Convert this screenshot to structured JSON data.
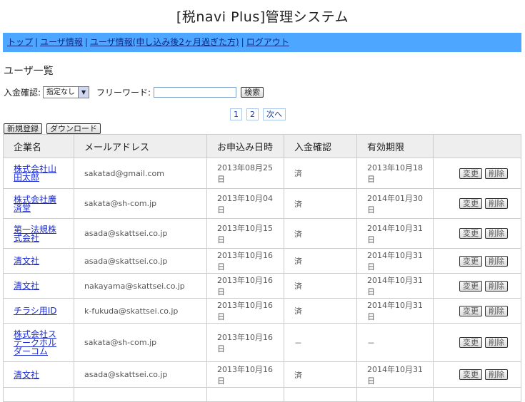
{
  "header": {
    "title": "[税navi Plus]管理システム"
  },
  "nav": {
    "items": [
      "トップ",
      "ユーザ情報",
      "ユーザ情報(申し込み後2ヶ月過ぎた方)",
      "ログアウト"
    ],
    "separator": "|"
  },
  "section": {
    "title": "ユーザ一覧"
  },
  "filter": {
    "payment_label": "入金確認:",
    "payment_value": "指定なし",
    "freeword_label": "フリーワード:",
    "freeword_value": "",
    "search_button": "検索"
  },
  "pager": {
    "pages": [
      "1",
      "2"
    ],
    "next": "次へ"
  },
  "actions": {
    "new_button": "新規登録",
    "download_button": "ダウンロード"
  },
  "table": {
    "columns": [
      "企業名",
      "メールアドレス",
      "お申込み日時",
      "入金確認",
      "有効期限",
      ""
    ],
    "edit_label": "変更",
    "delete_label": "削除",
    "rows": [
      {
        "company": "株式会社山田太郎",
        "email": "sakatad@gmail.com",
        "applied": "2013年08月25日",
        "payment": "済",
        "expiry": "2013年10月18日"
      },
      {
        "company": "株式会社廣済堂",
        "email": "sakata@sh-com.jp",
        "applied": "2013年10月04日",
        "payment": "済",
        "expiry": "2014年01月30日"
      },
      {
        "company": "第一法規株式会社",
        "email": "asada@skattsei.co.jp",
        "applied": "2013年10月15日",
        "payment": "済",
        "expiry": "2014年10月31日"
      },
      {
        "company": "清文社",
        "email": "asada@skattsei.co.jp",
        "applied": "2013年10月16日",
        "payment": "済",
        "expiry": "2014年10月31日"
      },
      {
        "company": "清文社",
        "email": "nakayama@skattsei.co.jp",
        "applied": "2013年10月16日",
        "payment": "済",
        "expiry": "2014年10月31日"
      },
      {
        "company": "チラシ用ID",
        "email": "k-fukuda@skattsei.co.jp",
        "applied": "2013年10月16日",
        "payment": "済",
        "expiry": "2014年10月31日"
      },
      {
        "company": "株式会社ステークホルダーコム",
        "email": "sakata@sh-com.jp",
        "applied": "2013年10月16日",
        "payment": "－",
        "expiry": "－"
      },
      {
        "company": "清文社",
        "email": "asada@skattsei.co.jp",
        "applied": "2013年10月16日",
        "payment": "済",
        "expiry": "2014年10月31日"
      }
    ]
  }
}
